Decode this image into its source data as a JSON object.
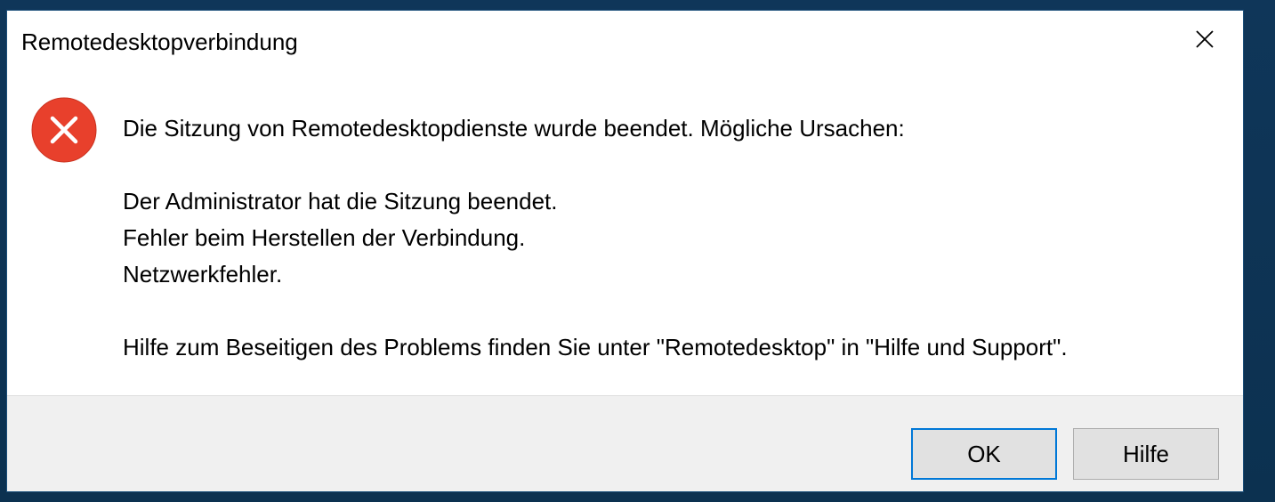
{
  "window": {
    "title": "Remotedesktopverbindung"
  },
  "message": {
    "headline": "Die Sitzung von Remotedesktopdienste wurde beendet. Mögliche Ursachen:",
    "reasons": [
      "Der Administrator hat die Sitzung beendet.",
      "Fehler beim Herstellen der Verbindung.",
      "Netzwerkfehler."
    ],
    "help_hint": "Hilfe zum Beseitigen des Problems finden Sie unter \"Remotedesktop\" in \"Hilfe und Support\"."
  },
  "buttons": {
    "ok_label": "OK",
    "help_label": "Hilfe"
  },
  "icons": {
    "status": "error-icon",
    "close": "close-icon"
  },
  "colors": {
    "error_red": "#e8402c",
    "accent_blue": "#0078d7",
    "footer_bg": "#f0f0f0",
    "desktop_bg": "#0f3a5f"
  }
}
